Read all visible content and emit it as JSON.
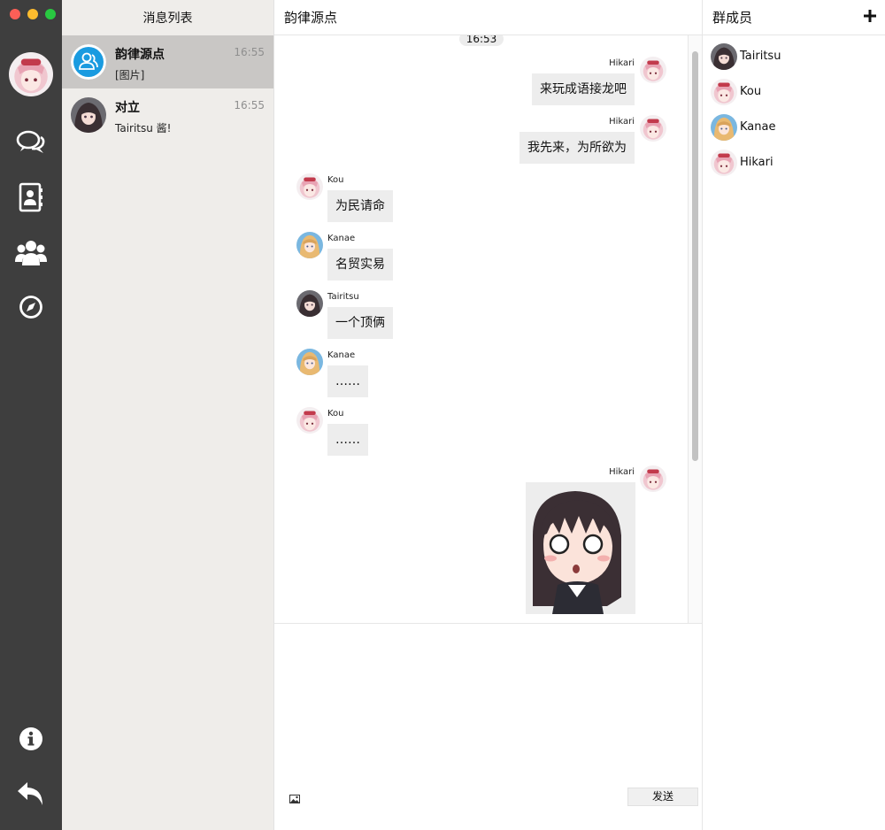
{
  "conversation_list": {
    "title": "消息列表",
    "items": [
      {
        "name": "韵律源点",
        "time": "16:55",
        "preview": "[图片]"
      },
      {
        "name": "对立",
        "time": "16:55",
        "preview": "Tairitsu 酱!"
      }
    ]
  },
  "chat": {
    "title": "韵律源点",
    "time_divider": "16:53",
    "messages": [
      {
        "sender": "Hikari",
        "text": "来玩成语接龙吧"
      },
      {
        "sender": "Hikari",
        "text": "我先来，为所欲为"
      },
      {
        "sender": "Kou",
        "text": "为民请命"
      },
      {
        "sender": "Kanae",
        "text": "名贸实易"
      },
      {
        "sender": "Tairitsu",
        "text": "一个顶俩"
      },
      {
        "sender": "Kanae",
        "text": "……"
      },
      {
        "sender": "Kou",
        "text": "……"
      },
      {
        "sender": "Hikari",
        "text": ""
      }
    ],
    "send_label": "发送"
  },
  "members": {
    "title": "群成员",
    "items": [
      "Tairitsu",
      "Kou",
      "Kanae",
      "Hikari"
    ]
  },
  "icons": {
    "nav": [
      "chat-icon",
      "contacts-icon",
      "group-icon",
      "discover-icon",
      "info-icon",
      "back-icon"
    ],
    "composer": "image-icon",
    "members_add": "plus-icon"
  },
  "colors": {
    "sidebar": "#3e3e3e",
    "list_bg": "#efedea",
    "active_row": "#c9c7c5",
    "bubble": "#ededed",
    "group_icon_blue": "#1a9be0"
  }
}
